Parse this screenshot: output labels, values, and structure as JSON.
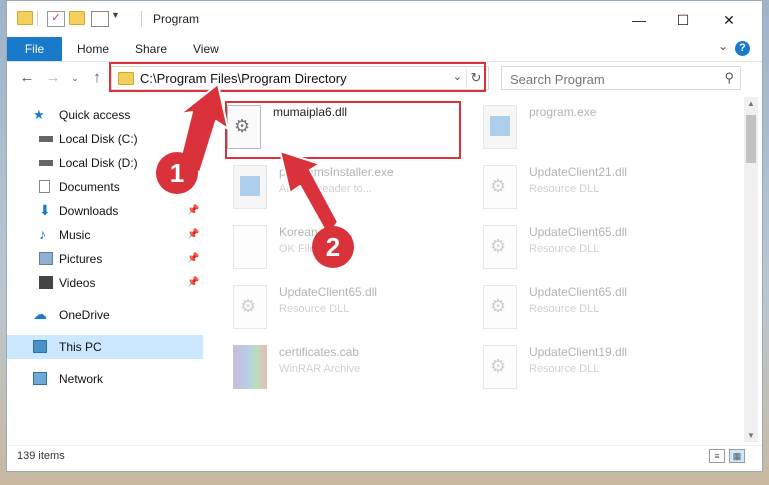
{
  "window": {
    "title": "Program",
    "controls": {
      "minimize": "—",
      "maximize": "☐",
      "close": "✕"
    }
  },
  "ribbon": {
    "tabs": [
      "File",
      "Home",
      "Share",
      "View"
    ],
    "help": "?"
  },
  "nav": {
    "address": "C:\\Program Files\\Program Directory",
    "search_placeholder": "Search Program"
  },
  "sidebar": {
    "items": [
      {
        "label": "Quick access",
        "icon": "star-icon",
        "color": "#1979ca"
      },
      {
        "label": "Local Disk (C:)",
        "icon": "drive-icon",
        "color": "#666"
      },
      {
        "label": "Local Disk (D:)",
        "icon": "drive-icon",
        "color": "#666"
      },
      {
        "label": "Documents",
        "icon": "document-icon",
        "color": "#888"
      },
      {
        "label": "Downloads",
        "icon": "download-icon",
        "color": "#1979ca"
      },
      {
        "label": "Music",
        "icon": "music-icon",
        "color": "#1979ca"
      },
      {
        "label": "Pictures",
        "icon": "pictures-icon",
        "color": "#5d7fa3"
      },
      {
        "label": "Videos",
        "icon": "videos-icon",
        "color": "#444"
      },
      {
        "label": "OneDrive",
        "icon": "cloud-icon",
        "color": "#1979ca"
      },
      {
        "label": "This PC",
        "icon": "computer-icon",
        "color": "#4a90c9"
      },
      {
        "label": "Network",
        "icon": "network-icon",
        "color": "#4a90c9"
      }
    ]
  },
  "files": [
    {
      "name": "mumaipla6.dll",
      "desc": "",
      "highlight": true
    },
    {
      "name": "program.exe",
      "desc": ""
    },
    {
      "name": "programsInstaller.exe",
      "desc": "ALF Reneader to..."
    },
    {
      "name": "UpdateClient21.dll",
      "desc": "Resource DLL"
    },
    {
      "name": "Korean",
      "desc": "OK File"
    },
    {
      "name": "UpdateClient65.dll",
      "desc": "Resource DLL"
    },
    {
      "name": "UpdateClient65.dll",
      "desc": "Resource DLL"
    },
    {
      "name": "UpdateClient65.dll",
      "desc": "Resource DLL"
    },
    {
      "name": "certificates.cab",
      "desc": "WinRAR Archive"
    },
    {
      "name": "UpdateClient19.dll",
      "desc": "Resource DLL"
    }
  ],
  "status": {
    "count": "139 items"
  },
  "callouts": {
    "one": "1",
    "two": "2",
    "color": "#d9323a"
  }
}
